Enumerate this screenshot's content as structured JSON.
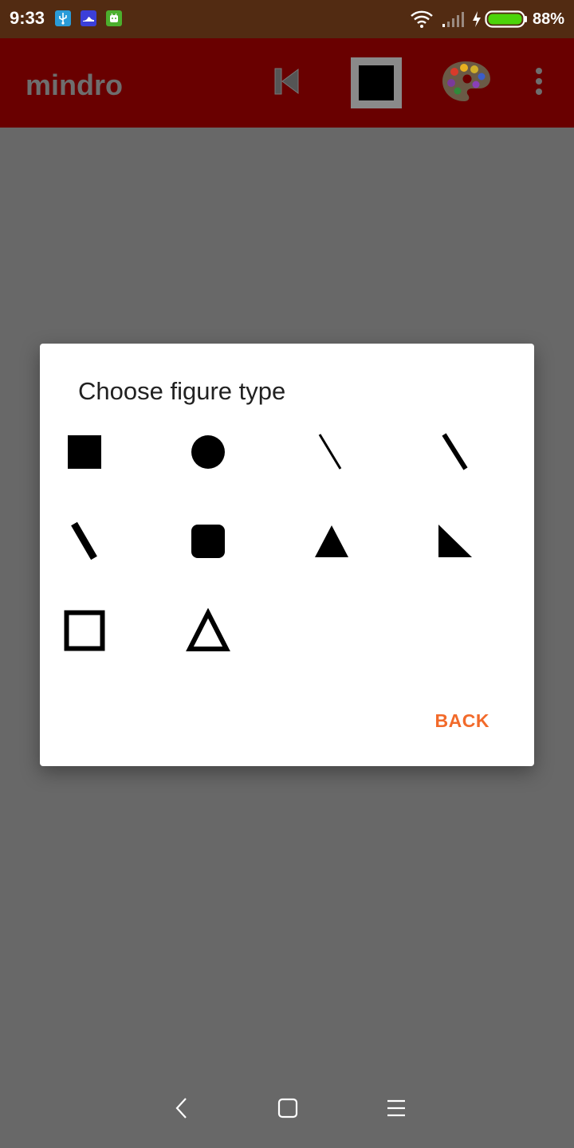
{
  "status_bar": {
    "time": "9:33",
    "notification_icons": [
      "usb-icon",
      "shoe-icon",
      "android-icon"
    ],
    "battery_percent": "88%",
    "battery_level": 0.88,
    "colors": {
      "background": "#522b12",
      "battery_fill": "#4cd40a"
    }
  },
  "app_bar": {
    "title": "mindro",
    "actions": [
      "skip-previous-icon",
      "current-shape-square-icon",
      "palette-icon",
      "more-vert-icon"
    ],
    "colors": {
      "background": "#690000"
    }
  },
  "dialog": {
    "title": "Choose figure type",
    "figures": [
      {
        "name": "filled-square-icon"
      },
      {
        "name": "filled-circle-icon"
      },
      {
        "name": "thin-line-icon"
      },
      {
        "name": "medium-line-icon"
      },
      {
        "name": "thick-line-icon"
      },
      {
        "name": "rounded-square-icon"
      },
      {
        "name": "filled-triangle-icon"
      },
      {
        "name": "right-triangle-icon"
      },
      {
        "name": "outline-square-icon"
      },
      {
        "name": "outline-triangle-icon"
      }
    ],
    "back_label": "BACK",
    "colors": {
      "accent": "#f26a2a"
    }
  },
  "nav_bar": {
    "buttons": [
      "back-icon",
      "home-icon",
      "menu-icon"
    ]
  }
}
